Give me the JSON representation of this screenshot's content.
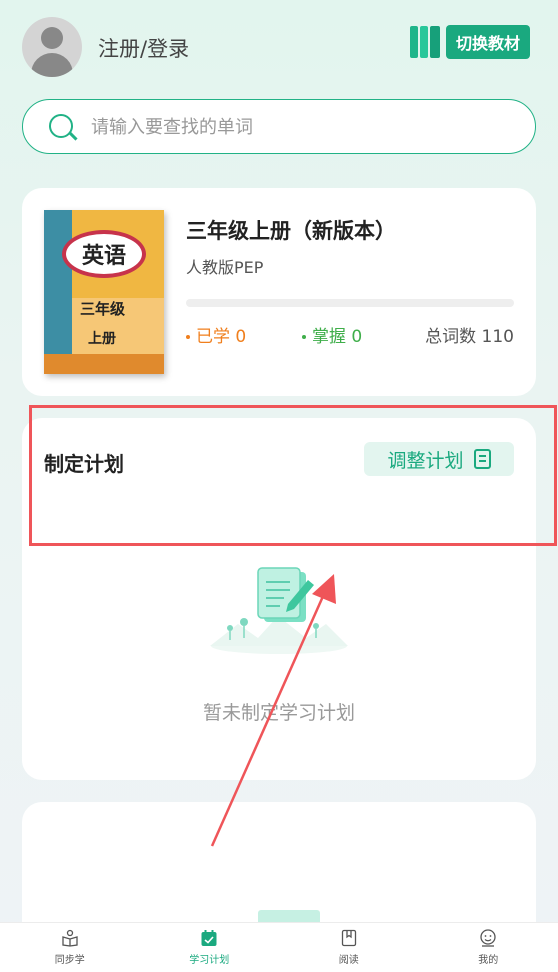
{
  "header": {
    "login_label": "注册/登录",
    "switch_textbook_label": "切换教材"
  },
  "search": {
    "placeholder": "请输入要查找的单词"
  },
  "book": {
    "cover_subject": "英语",
    "cover_grade": "三年级",
    "cover_term": "上册",
    "title": "三年级上册（新版本）",
    "edition": "人教版PEP",
    "progress_fraction": 0,
    "learned_label": "已学",
    "learned_count": "0",
    "mastered_label": "掌握",
    "mastered_count": "0",
    "total_label": "总词数",
    "total_count": "110"
  },
  "plan": {
    "title": "制定计划",
    "adjust_label": "调整计划",
    "empty_text": "暂未制定学习计划"
  },
  "tabs": [
    {
      "label": "同步学",
      "icon": "book-reader-icon",
      "active": false
    },
    {
      "label": "学习计划",
      "icon": "calendar-check-icon",
      "active": true
    },
    {
      "label": "阅读",
      "icon": "bookmark-book-icon",
      "active": false
    },
    {
      "label": "我的",
      "icon": "user-icon",
      "active": false
    }
  ],
  "colors": {
    "accent": "#1aa97f",
    "learned": "#f07f1d",
    "mastered": "#3fae4a",
    "highlight": "#ef5559"
  }
}
